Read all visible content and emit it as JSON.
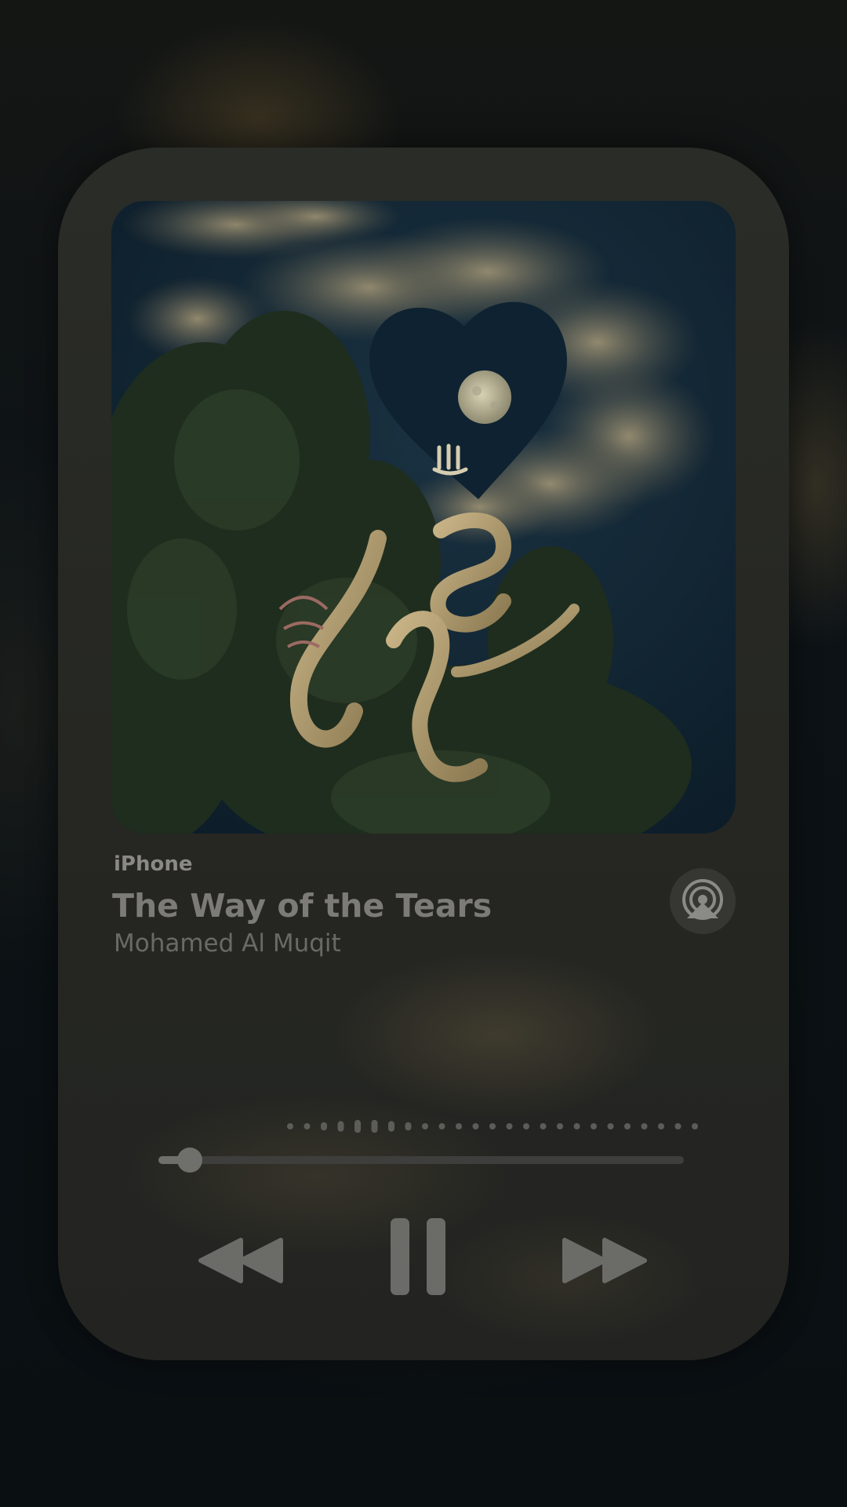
{
  "player": {
    "output_device": "iPhone",
    "track_title": "The Way of the Tears",
    "artist": "Mohamed Al Muqit",
    "progress_fraction": 0.06,
    "state": "playing"
  },
  "controls": {
    "rewind": "backward-icon",
    "play_pause": "pause-icon",
    "forward": "forward-icon",
    "airplay": "airplay-audio-icon"
  },
  "colors": {
    "card": "#262723",
    "text_primary": "#7c7b77",
    "text_secondary": "#6a6965",
    "controls": "#6b6b68"
  }
}
